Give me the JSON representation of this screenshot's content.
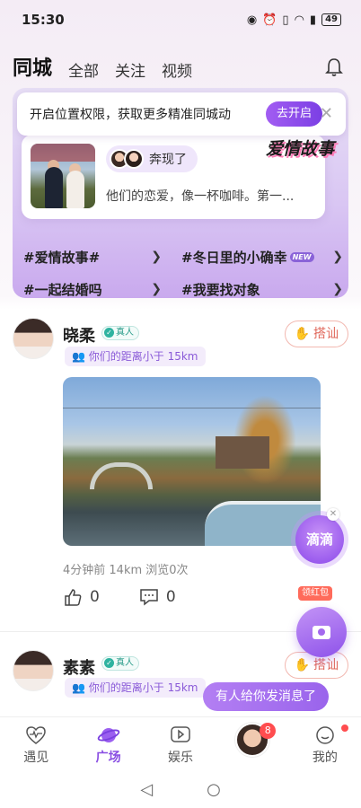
{
  "status": {
    "time": "15:30",
    "battery": "49"
  },
  "top_tabs": [
    {
      "label": "同城",
      "active": true
    },
    {
      "label": "全部",
      "active": false
    },
    {
      "label": "关注",
      "active": false
    },
    {
      "label": "视频",
      "active": false
    }
  ],
  "location_toast": {
    "message": "开启位置权限，获取更多精准同城动",
    "button": "去开启"
  },
  "story": {
    "badge": "爱情故事",
    "pill_label": "奔现了",
    "desc": "他们的恋爱，像一杯咖啡。第一..."
  },
  "topics": [
    {
      "label": "#爱情故事#",
      "badge": ""
    },
    {
      "label": "#冬日里的小确幸",
      "badge": "NEW"
    },
    {
      "label": "#一起结婚吗",
      "badge": ""
    },
    {
      "label": "#我要找对象",
      "badge": ""
    }
  ],
  "posts": [
    {
      "name": "晓柔",
      "verified": "真人",
      "distance": "你们的距离小于 15km",
      "greet": "搭讪",
      "meta": "4分钟前  14km  浏览0次",
      "likes": "0",
      "comments": "0"
    },
    {
      "name": "素素",
      "verified": "真人",
      "distance": "你们的距离小于 15km",
      "greet": "搭讪"
    }
  ],
  "floating": {
    "didi": "滴滴",
    "red_packet": "领红包",
    "message_toast": "有人给你发消息了"
  },
  "bottom_nav": [
    {
      "label": "遇见",
      "icon": "heartbeat-icon"
    },
    {
      "label": "广场",
      "icon": "planet-icon",
      "active": true
    },
    {
      "label": "娱乐",
      "icon": "play-icon"
    },
    {
      "label": "",
      "icon": "avatar",
      "badge": "8"
    },
    {
      "label": "我的",
      "icon": "face-icon"
    }
  ]
}
